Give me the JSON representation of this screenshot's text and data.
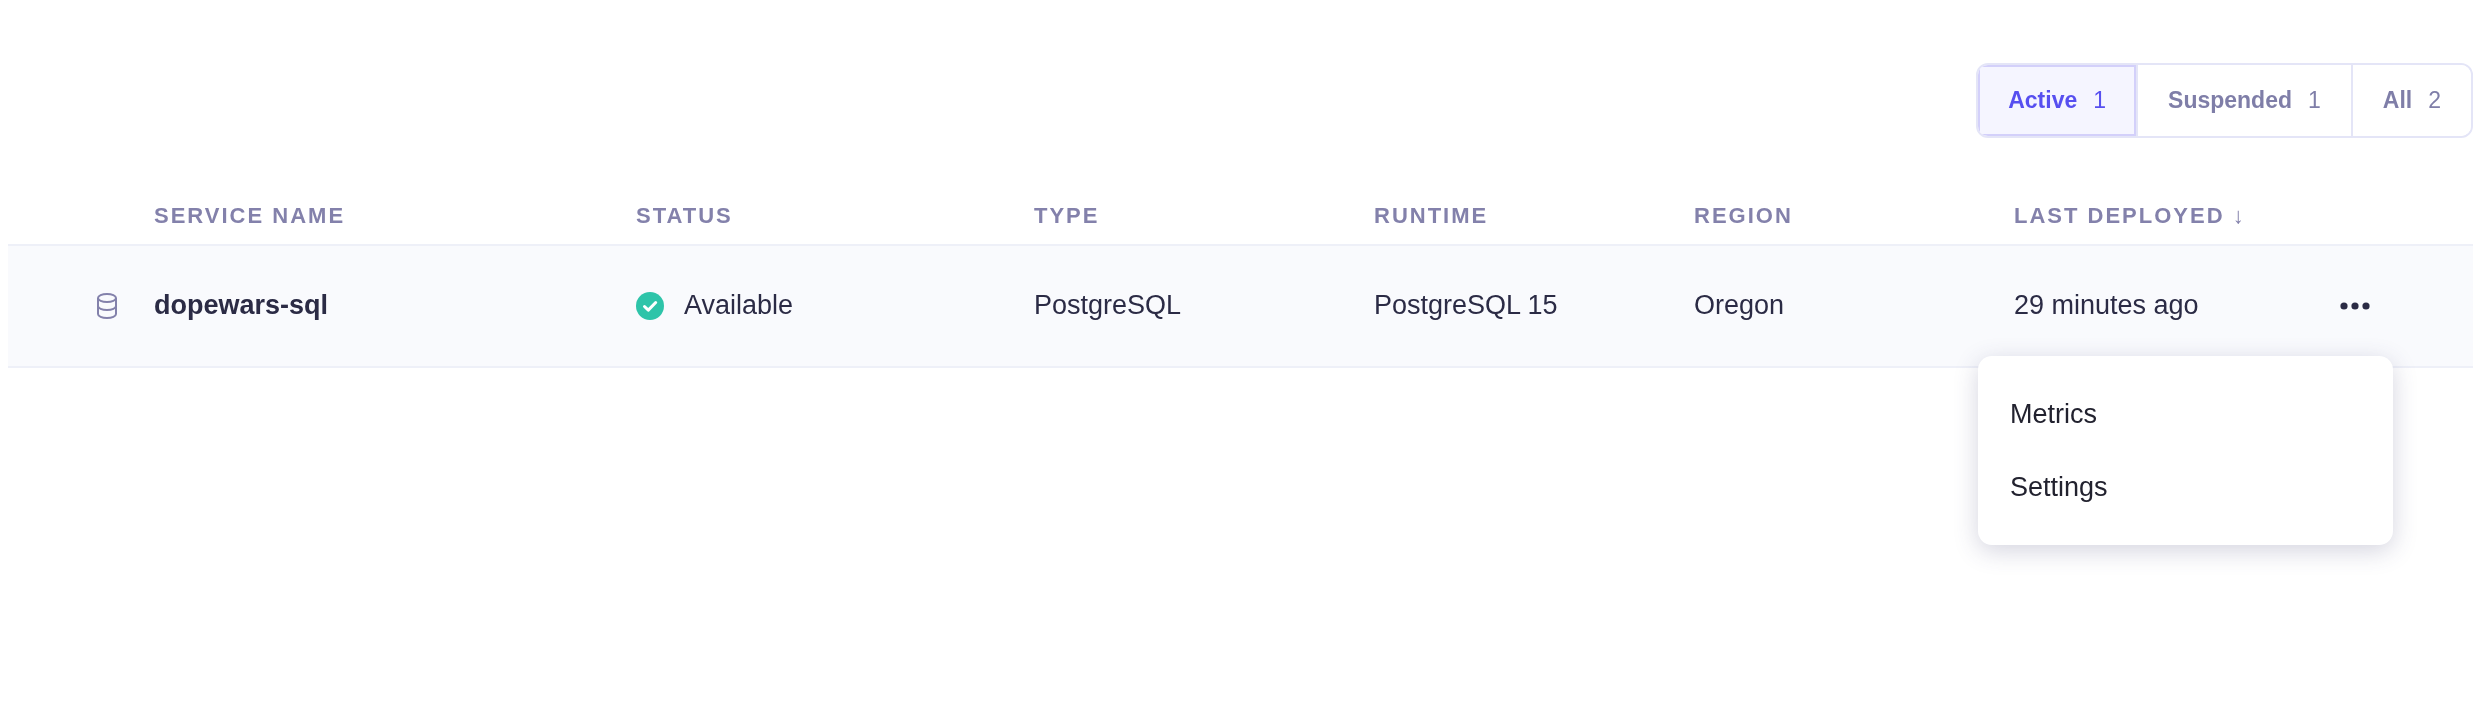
{
  "filters": [
    {
      "label": "Active",
      "count": "1",
      "selected": true
    },
    {
      "label": "Suspended",
      "count": "1",
      "selected": false
    },
    {
      "label": "All",
      "count": "2",
      "selected": false
    }
  ],
  "table": {
    "columns": [
      {
        "label": "SERVICE NAME"
      },
      {
        "label": "STATUS"
      },
      {
        "label": "TYPE"
      },
      {
        "label": "RUNTIME"
      },
      {
        "label": "REGION"
      },
      {
        "label": "LAST DEPLOYED",
        "sort_glyph": "↓"
      }
    ],
    "rows": [
      {
        "name": "dopewars-sql",
        "status": {
          "label": "Available",
          "kind": "ok"
        },
        "type": "PostgreSQL",
        "runtime": "PostgreSQL 15",
        "region": "Oregon",
        "last_deployed": "29 minutes ago",
        "menu_open": true
      }
    ]
  },
  "menu": {
    "items": [
      {
        "label": "Metrics"
      },
      {
        "label": "Settings"
      }
    ]
  }
}
